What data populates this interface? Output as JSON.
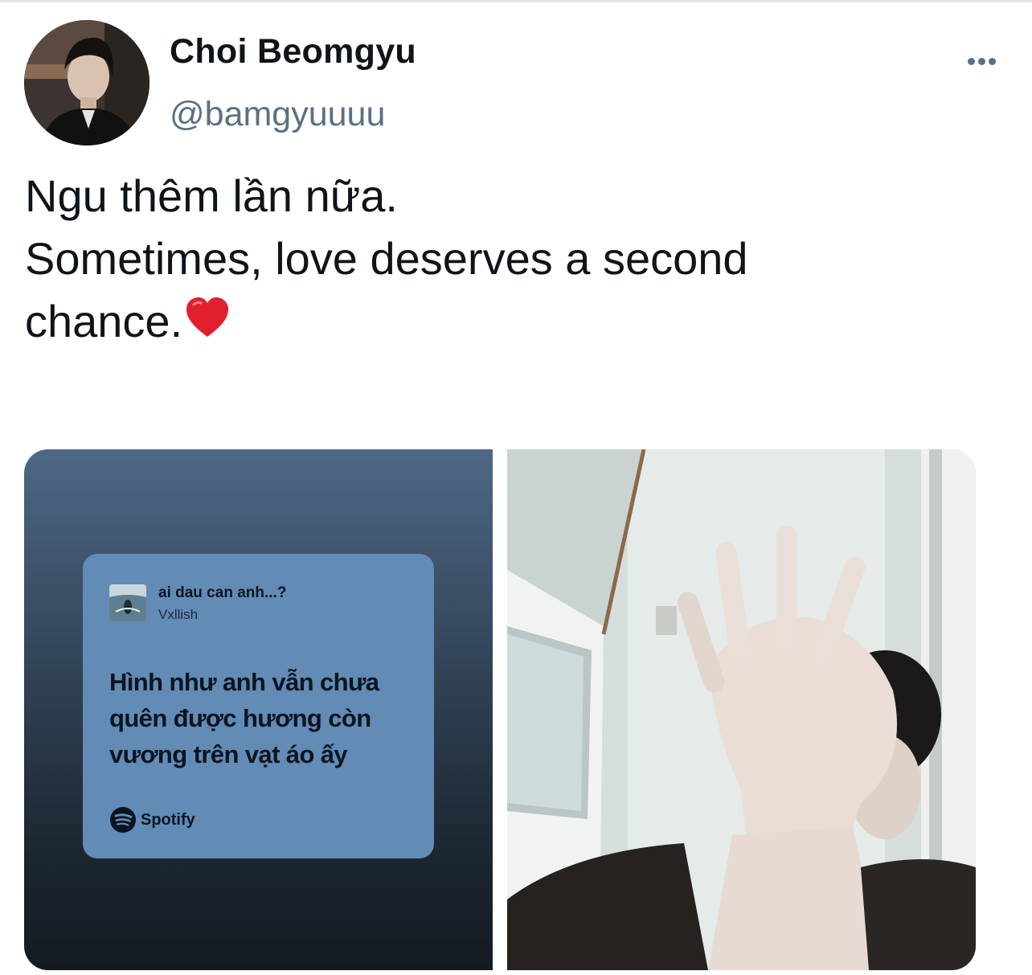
{
  "tweet": {
    "display_name": "Choi Beomgyu",
    "handle": "@bamgyuuuu",
    "text_lines": [
      "Ngu thêm lần nữa.",
      "Sometimes, love deserves a second",
      "chance."
    ],
    "emoji": "red-heart"
  },
  "media": {
    "lyric_card": {
      "song_title": "ai dau can anh...?",
      "artist": "Vxllish",
      "lyrics": [
        "Hình như anh vẫn chưa",
        "quên được hương còn",
        "vương trên vạt áo ấy"
      ],
      "brand": "Spotify",
      "card_color": "#628bb5"
    },
    "photo": {
      "icon": "photo-hand-over-face"
    }
  },
  "colors": {
    "text_primary": "#0f1419",
    "text_secondary": "#5b7083",
    "heart": "#e0202e"
  }
}
